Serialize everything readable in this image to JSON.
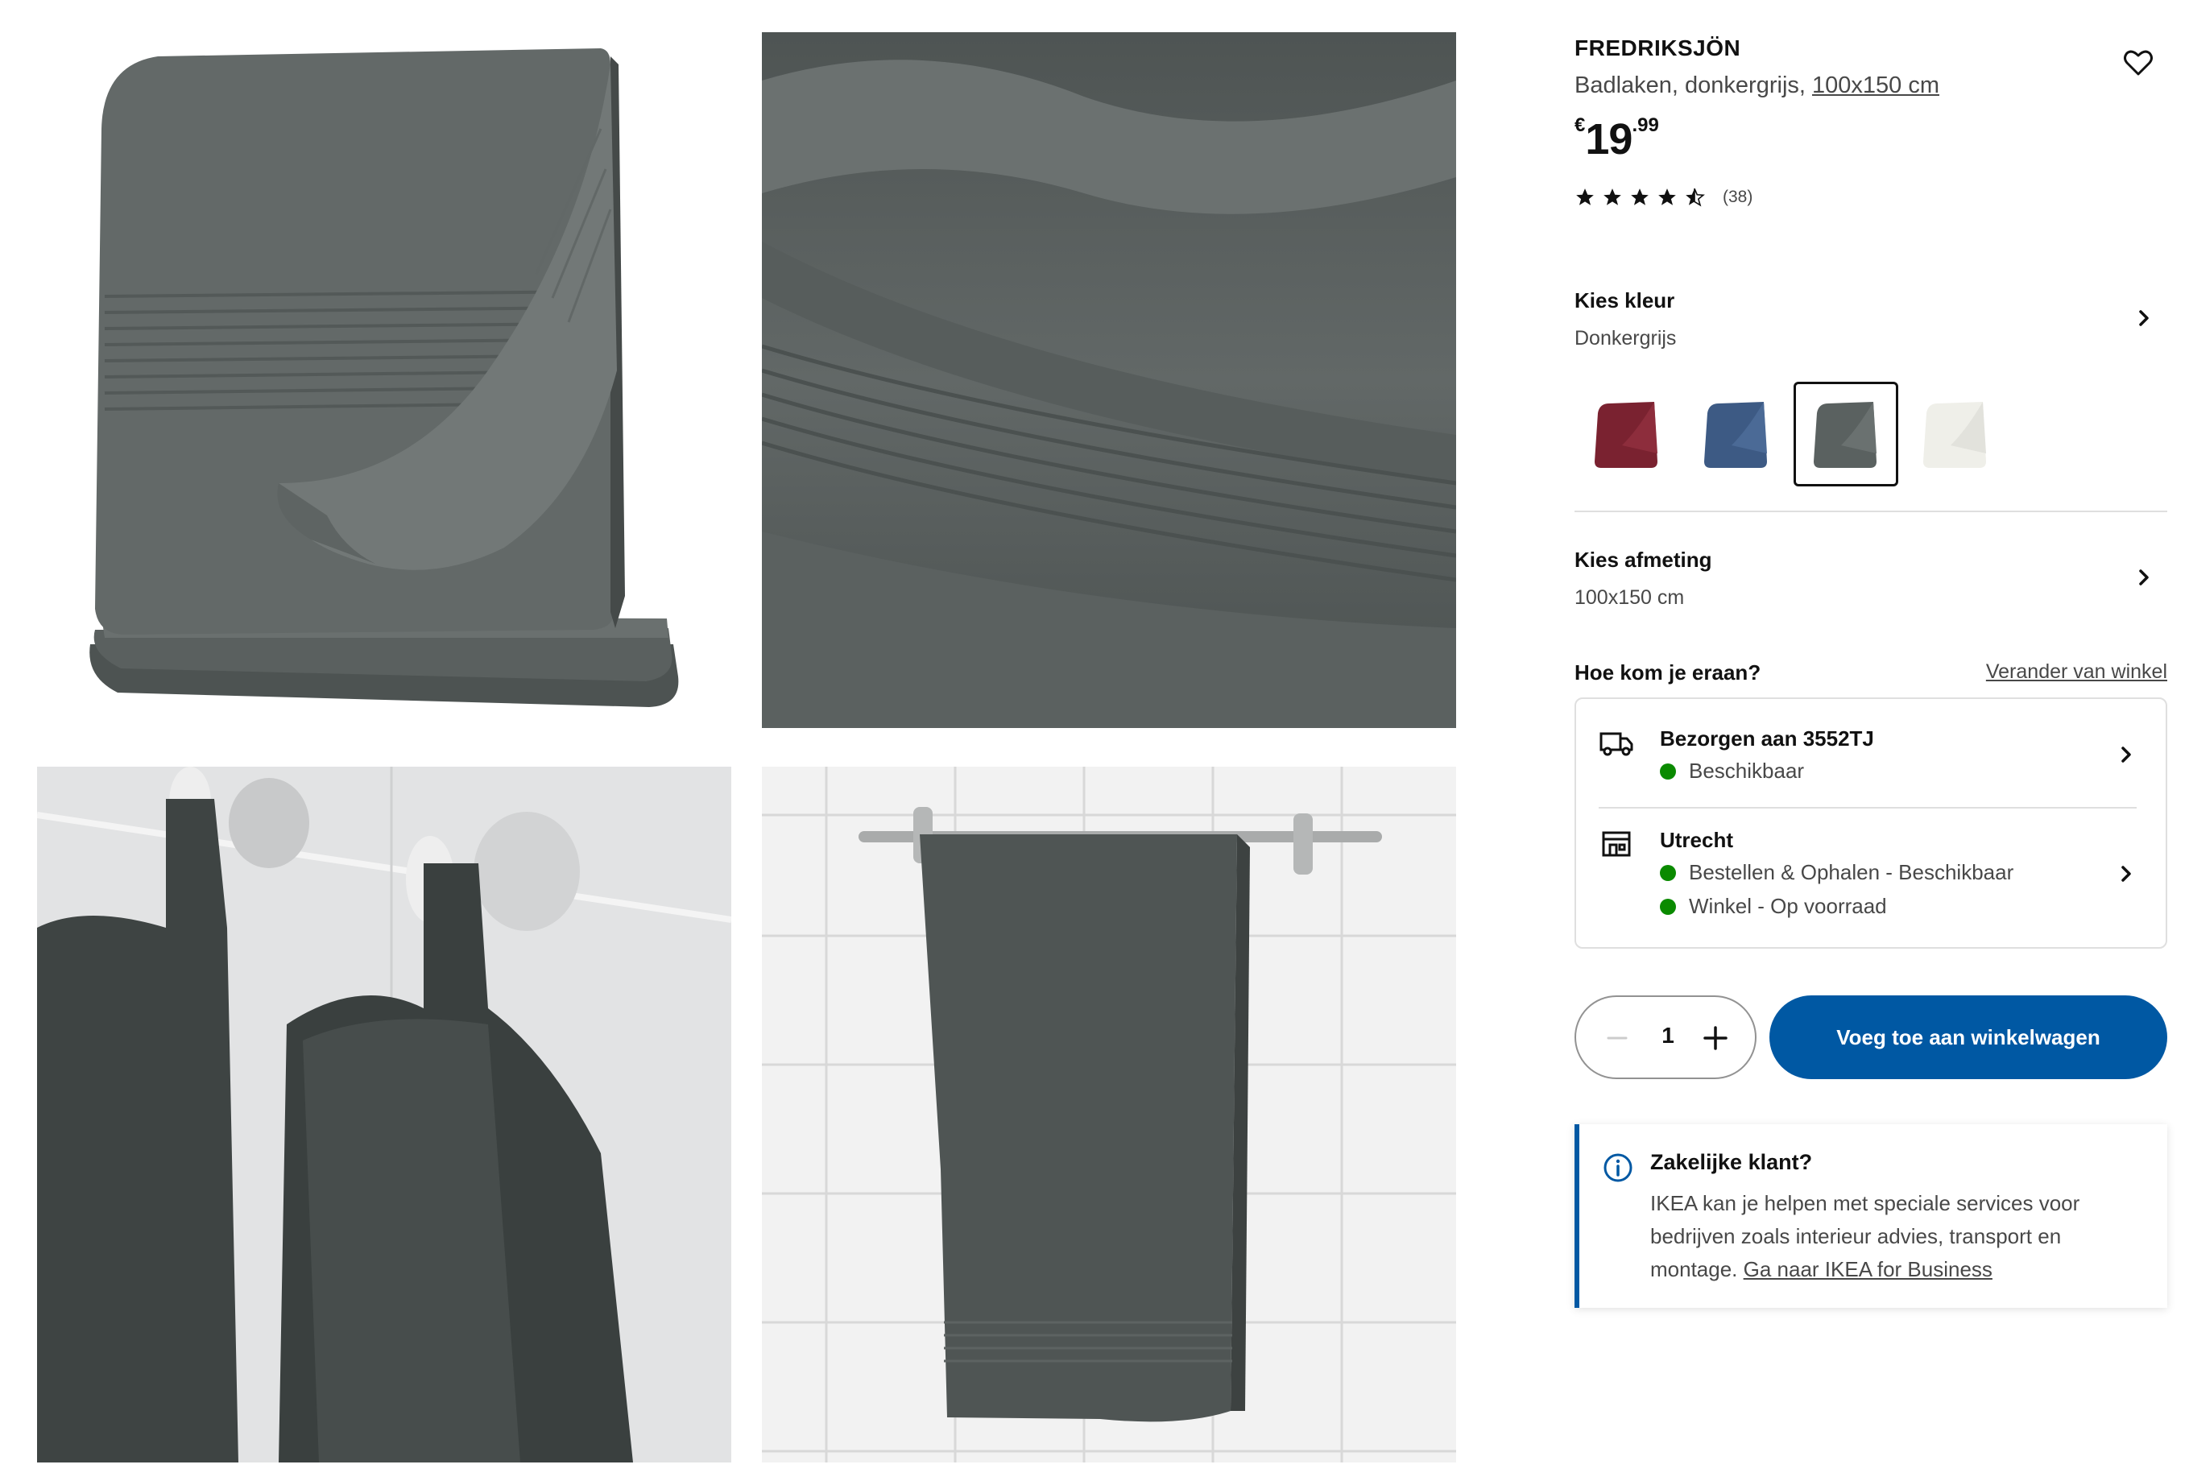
{
  "gallery": {
    "images": [
      {
        "name": "folded-towel-image"
      },
      {
        "name": "towel-texture-closeup-image"
      },
      {
        "name": "towels-on-hooks-image"
      },
      {
        "name": "towel-on-rail-image"
      }
    ]
  },
  "product": {
    "name": "FREDRIKSJÖN",
    "description": "Badlaken, donkergrijs, ",
    "size_link": "100x150 cm",
    "price": {
      "currency": "€",
      "integer": "19",
      "decimal": ".99"
    },
    "rating": {
      "stars": 4.5,
      "max": 5,
      "count": "(38)"
    },
    "favorite_icon": "heart-outline-icon"
  },
  "color": {
    "title": "Kies kleur",
    "selected": "Donkergrijs",
    "swatches": [
      {
        "name": "swatch-dark-red",
        "color": "#7a2230",
        "selected": false
      },
      {
        "name": "swatch-dark-blue",
        "color": "#3d5a84",
        "selected": false
      },
      {
        "name": "swatch-dark-grey",
        "color": "#5a6160",
        "selected": true
      },
      {
        "name": "swatch-white",
        "color": "#efefe9",
        "selected": false
      }
    ]
  },
  "size": {
    "title": "Kies afmeting",
    "selected": "100x150 cm"
  },
  "availability": {
    "title": "Hoe kom je eraan?",
    "change_store": "Verander van winkel",
    "delivery": {
      "title": "Bezorgen aan 3552TJ",
      "status": "Beschikbaar",
      "icon": "truck-icon"
    },
    "store": {
      "title": "Utrecht",
      "click_collect": "Bestellen & Ophalen - Beschikbaar",
      "in_store": "Winkel - Op voorraad",
      "icon": "store-icon"
    },
    "status_color": "#0a8a00"
  },
  "cart": {
    "quantity": "1",
    "button_label": "Voeg toe aan winkelwagen",
    "button_color": "#0058a3"
  },
  "business": {
    "title": "Zakelijke klant?",
    "text": "IKEA kan je helpen met speciale services voor bedrijven zoals interieur advies, transport en montage. ",
    "link": "Ga naar IKEA for Business",
    "icon": "info-icon"
  }
}
